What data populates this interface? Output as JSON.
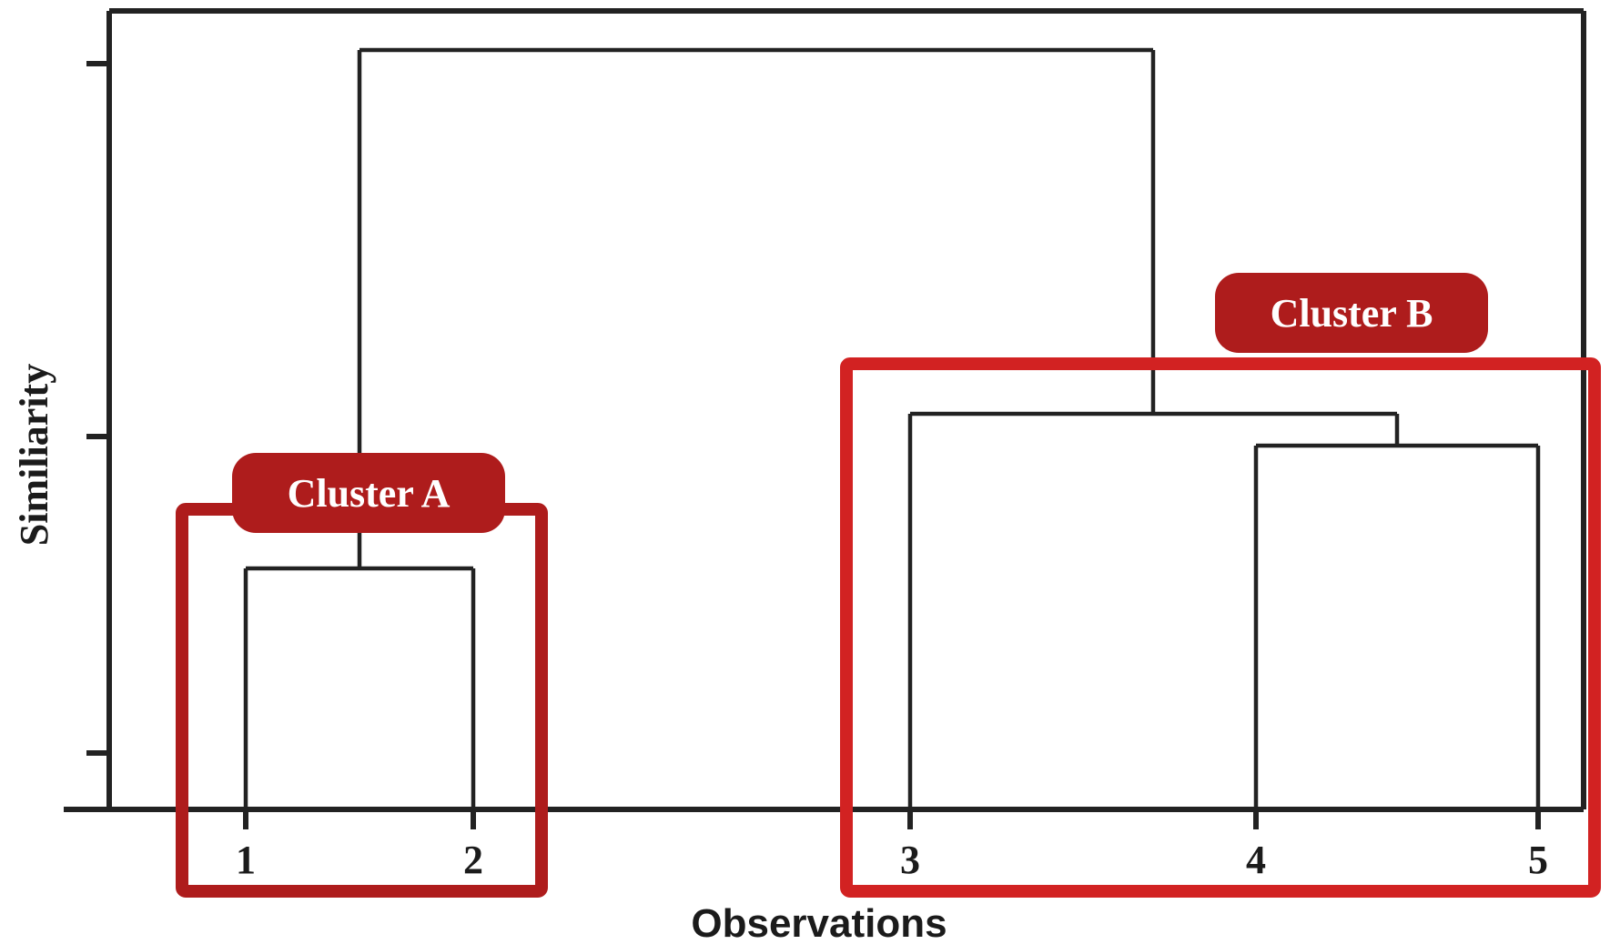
{
  "chart_data": {
    "type": "dendrogram",
    "title": "",
    "xlabel": "Observations",
    "ylabel": "Similiarity",
    "observations": [
      "1",
      "2",
      "3",
      "4",
      "5"
    ],
    "ylim": [
      0,
      1
    ],
    "y_ticks": [
      0.07,
      0.46,
      0.99
    ],
    "hierarchy": {
      "height": 0.95,
      "children": [
        {
          "height": 0.3,
          "children": [
            {
              "leaf": "1"
            },
            {
              "leaf": "2"
            }
          ]
        },
        {
          "height": 0.49,
          "children": [
            {
              "leaf": "3"
            },
            {
              "height": 0.46,
              "children": [
                {
                  "leaf": "4"
                },
                {
                  "leaf": "5"
                }
              ]
            }
          ]
        }
      ]
    },
    "clusters": [
      {
        "name": "Cluster A",
        "members": [
          "1",
          "2"
        ]
      },
      {
        "name": "Cluster B",
        "members": [
          "3",
          "4",
          "5"
        ]
      }
    ]
  },
  "labels": {
    "cluster_a": "Cluster A",
    "cluster_b": "Cluster B"
  }
}
